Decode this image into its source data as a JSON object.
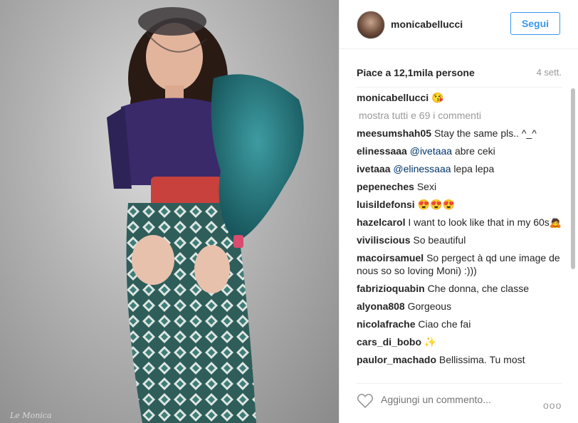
{
  "photo": {
    "watermark": "Le Monica"
  },
  "header": {
    "username": "monicabellucci",
    "follow_label": "Segui"
  },
  "stats": {
    "likes": "Piace a 12,1mila persone",
    "time_ago": "4 sett."
  },
  "caption": {
    "user": "monicabellucci",
    "text": "😘"
  },
  "show_all": "mostra tutti e 69 i commenti",
  "comments": [
    {
      "user": "meesumshah05",
      "text": "Stay the same pls.. ^_^"
    },
    {
      "user": "elinessaaa",
      "mention": "@ivetaaa",
      "text": " abre ceki"
    },
    {
      "user": "ivetaaa",
      "mention": "@elinessaaa",
      "text": " lepa lepa"
    },
    {
      "user": "pepeneches",
      "text": "Sexi"
    },
    {
      "user": "luisildefonsi",
      "text": "😍😍😍"
    },
    {
      "user": "hazelcarol",
      "text": "I want to look like that in my 60s🙇"
    },
    {
      "user": "viviliscious",
      "text": "So beautiful"
    },
    {
      "user": "macoirsamuel",
      "text": "So pergect à qd une image de nous so so loving Moni) :)))"
    },
    {
      "user": "fabrizioquabin",
      "text": "Che donna, che classe"
    },
    {
      "user": "alyona808",
      "text": "Gorgeous"
    },
    {
      "user": "nicolafrache",
      "text": "Ciao che fai"
    },
    {
      "user": "cars_di_bobo",
      "text": "✨"
    },
    {
      "user": "paulor_machado",
      "text": "Bellissima. Tu most"
    }
  ],
  "footer": {
    "comment_placeholder": "Aggiungi un commento...",
    "more_options": "ooo",
    "heart_icon": "heart-outline-icon"
  },
  "colors": {
    "accent": "#3897f0",
    "mention": "#003569",
    "muted": "#999999"
  }
}
